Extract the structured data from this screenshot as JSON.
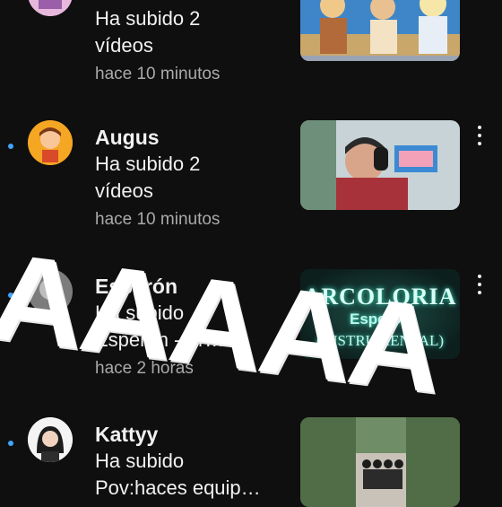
{
  "feed": {
    "items": [
      {
        "channel": "",
        "line1": "Ha subido 2",
        "line2": "vídeos",
        "time": "hace 10 minutos",
        "avatar_icon": "channel-avatar-pink",
        "thumb_text": "",
        "thumb_subtext": ""
      },
      {
        "channel": "Augus",
        "line1": "Ha subido 2",
        "line2": "vídeos",
        "time": "hace 10 minutos",
        "avatar_icon": "channel-avatar-orange",
        "thumb_text": "",
        "thumb_subtext": ""
      },
      {
        "channel": "Esperón",
        "line1": "Ha subido",
        "line2": "Esperón - Ar…",
        "time": "hace 2 horas",
        "avatar_icon": "channel-avatar-grey",
        "thumb_text": "ARCOLORIA",
        "thumb_subtext": "Esperón",
        "thumb_caption": "(INSTRUMENTAL)"
      },
      {
        "channel": "Kattyy",
        "line1": "Ha subido",
        "line2": "Pov:haces equip…",
        "time": "",
        "avatar_icon": "channel-avatar-white",
        "thumb_text": "",
        "thumb_subtext": ""
      }
    ]
  },
  "overlay": {
    "text": "AAAAA"
  },
  "icons": {
    "menu": "more-vert-icon",
    "unread": "unread-dot-icon"
  },
  "colors": {
    "background": "#0f0f0f",
    "unread_dot": "#3ea6ff",
    "secondary_text": "#aaaaaa"
  }
}
